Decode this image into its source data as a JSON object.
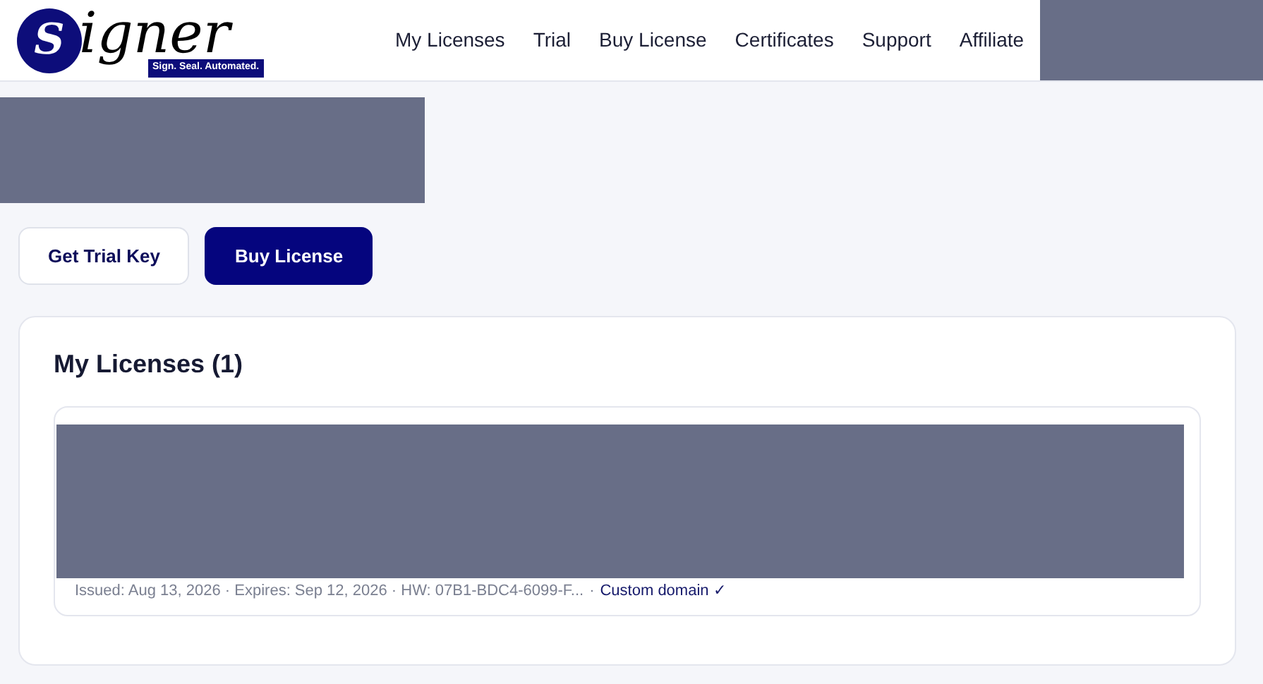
{
  "logo": {
    "mark": "S",
    "wordmark": "igner",
    "tagline": "Sign. Seal. Automated."
  },
  "nav": [
    {
      "label": "My Licenses"
    },
    {
      "label": "Trial"
    },
    {
      "label": "Buy License"
    },
    {
      "label": "Certificates"
    },
    {
      "label": "Support"
    },
    {
      "label": "Affiliate"
    }
  ],
  "actions": [
    {
      "label": "Get Trial Key",
      "kind": "secondary"
    },
    {
      "label": "Buy License",
      "kind": "primary"
    }
  ],
  "licenses": {
    "title": "My Licenses (1)",
    "items": [
      {
        "meta": "Issued: Aug 13, 2026 · Expires: Sep 12, 2026 · HW: 07B1-BDC4-6099-F...",
        "separator": "·",
        "domain": "Custom domain ✓"
      }
    ]
  }
}
